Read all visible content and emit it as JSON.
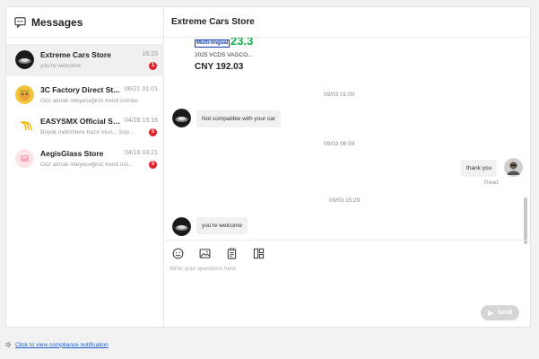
{
  "sidebar": {
    "title": "Messages",
    "conversations": [
      {
        "name": "Extreme Cars Store",
        "time": "16:23",
        "preview": "you're welcome",
        "badge": "1"
      },
      {
        "name": "3C Factory Direct St...",
        "time": "06/21 01:01",
        "preview": "Göz atmak isteyeceğiniz trend ürünler",
        "badge": ""
      },
      {
        "name": "EASYSMX Official St...",
        "time": "04/28 15:16",
        "preview": "Büyük indirimlere hazır olun... Süp...",
        "badge": "5"
      },
      {
        "name": "AegisGlass Store",
        "time": "04/16 03:21",
        "preview": "Göz atmak isteyeceğiniz trend ürü...",
        "badge": "5"
      }
    ]
  },
  "chat": {
    "store_name": "Extreme Cars Store",
    "product": {
      "banner_left": "Multi-lingual",
      "banner_right": "23.3",
      "name": "2025 VCDS VAGCO...",
      "price": "CNY 192.03"
    },
    "timestamps": [
      "09/03 01:00",
      "09/03 06:59",
      "09/03 15:29"
    ],
    "messages": [
      {
        "from": "store",
        "text": "Not compatible with your car"
      },
      {
        "from": "me",
        "text": "thank you",
        "status": "Read"
      },
      {
        "from": "store",
        "text": "you're welcome"
      }
    ],
    "input_placeholder": "Write your questions here",
    "send_label": "Send"
  },
  "footer": {
    "compliance_link": "Click to view compliance notification"
  },
  "colors": {
    "badge": "#e0202b",
    "link": "#1a5fd1",
    "send_disabled": "#d6d6d6"
  },
  "icons": [
    "message-icon",
    "emoji-icon",
    "image-icon",
    "order-icon",
    "product-icon",
    "send-icon",
    "info-icon"
  ]
}
